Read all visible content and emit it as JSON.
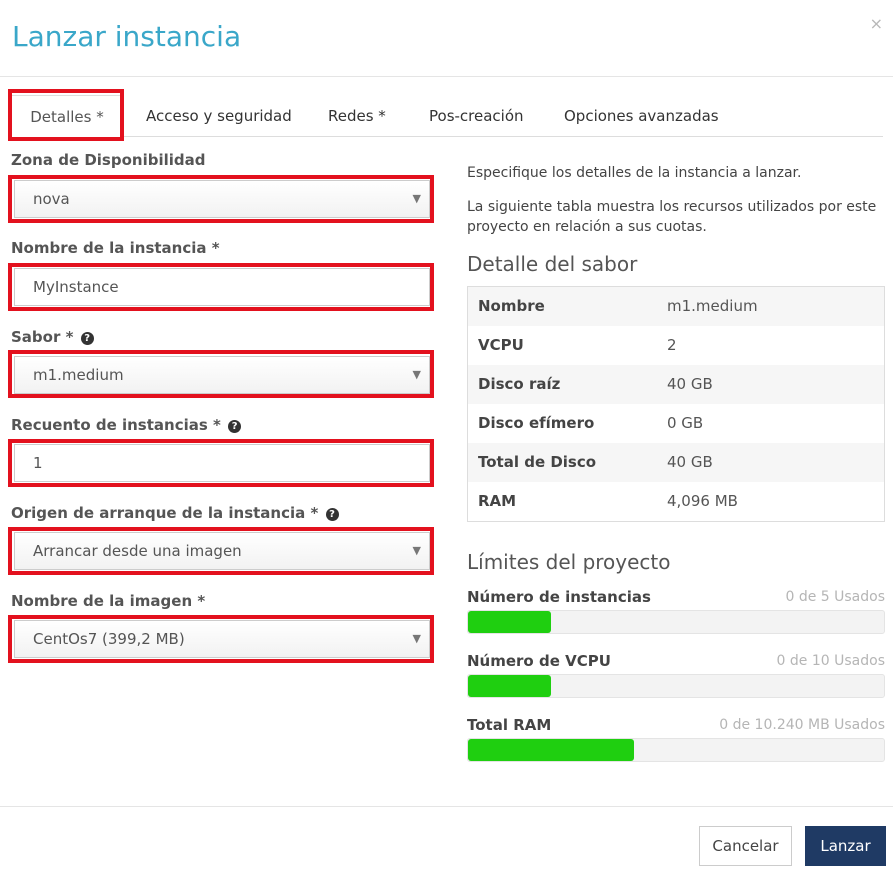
{
  "dialog": {
    "title": "Lanzar instancia",
    "close_glyph": "×"
  },
  "tabs": [
    {
      "label": "Detalles *"
    },
    {
      "label": "Acceso y seguridad"
    },
    {
      "label": "Redes *"
    },
    {
      "label": "Pos-creación"
    },
    {
      "label": "Opciones avanzadas"
    }
  ],
  "form": {
    "availability_zone": {
      "label": "Zona de Disponibilidad",
      "value": "nova"
    },
    "instance_name": {
      "label": "Nombre de la instancia *",
      "value": "MyInstance"
    },
    "flavor": {
      "label": "Sabor *",
      "value": "m1.medium"
    },
    "instance_count": {
      "label": "Recuento de instancias *",
      "value": "1"
    },
    "boot_source": {
      "label": "Origen de arranque de la instancia *",
      "value": "Arrancar desde una imagen"
    },
    "image_name": {
      "label": "Nombre de la imagen *",
      "value": "CentOs7 (399,2 MB)"
    }
  },
  "info": {
    "line1": "Especifique los detalles de la instancia a lanzar.",
    "line2": "La siguiente tabla muestra los recursos utilizados por este proyecto en relación a sus cuotas.",
    "flavor_title": "Detalle del sabor",
    "flavor_rows": [
      {
        "key": "Nombre",
        "value": "m1.medium"
      },
      {
        "key": "VCPU",
        "value": "2"
      },
      {
        "key": "Disco raíz",
        "value": "40 GB"
      },
      {
        "key": "Disco efímero",
        "value": "0 GB"
      },
      {
        "key": "Total de Disco",
        "value": "40 GB"
      },
      {
        "key": "RAM",
        "value": "4,096 MB"
      }
    ],
    "limits_title": "Límites del proyecto",
    "limits": [
      {
        "label": "Número de instancias",
        "used": "0 de 5 Usados",
        "fill_fraction": 0.2
      },
      {
        "label": "Número de VCPU",
        "used": "0 de 10 Usados",
        "fill_fraction": 0.2
      },
      {
        "label": "Total RAM",
        "used": "0 de 10.240 MB Usados",
        "fill_fraction": 0.4
      }
    ]
  },
  "footer": {
    "cancel_label": "Cancelar",
    "launch_label": "Lanzar"
  },
  "colors": {
    "title": "#3aa7c9",
    "highlight": "#e3111e",
    "bar_fill": "#1fcf10",
    "primary_button": "#1f3a64"
  },
  "icons": {
    "help": "question-circle-icon",
    "caret": "caret-down-icon",
    "close": "close-icon"
  }
}
